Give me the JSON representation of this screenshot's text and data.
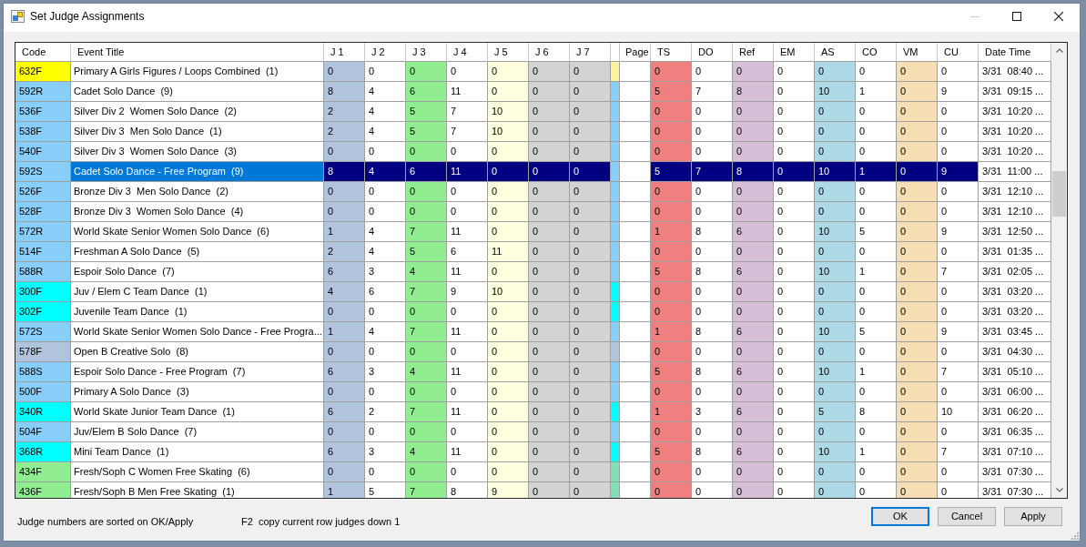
{
  "window": {
    "title": "Set Judge Assignments",
    "title_buttons": [
      {
        "kind": "minimize",
        "disabled": true
      },
      {
        "kind": "maximize",
        "disabled": false
      },
      {
        "kind": "close",
        "disabled": false
      }
    ]
  },
  "table": {
    "columns": [
      {
        "label": "Code",
        "kind": "code"
      },
      {
        "label": "Event Title",
        "kind": "title"
      },
      {
        "label": "J 1",
        "kind": "number",
        "color": "#b0c4de"
      },
      {
        "label": "J 2",
        "kind": "number"
      },
      {
        "label": "J 3",
        "kind": "number",
        "color": "#90ee90"
      },
      {
        "label": "J 4",
        "kind": "number"
      },
      {
        "label": "J 5",
        "kind": "number",
        "color": "#ffffe0"
      },
      {
        "label": "J 6",
        "kind": "number",
        "color": "#d3d3d3"
      },
      {
        "label": "J 7",
        "kind": "number",
        "color": "#d3d3d3"
      },
      {
        "kind": "marker"
      },
      {
        "label": "Page",
        "kind": "page"
      },
      {
        "label": "TS",
        "kind": "number",
        "color": "#f08080"
      },
      {
        "label": "DO",
        "kind": "number"
      },
      {
        "label": "Ref",
        "kind": "number",
        "color": "#d8bfd8"
      },
      {
        "label": "EM",
        "kind": "number"
      },
      {
        "label": "AS",
        "kind": "number",
        "color": "#add8e6"
      },
      {
        "label": "CO",
        "kind": "number"
      },
      {
        "label": "VM",
        "kind": "number",
        "color": "#f5deb3"
      },
      {
        "label": "CU",
        "kind": "number"
      },
      {
        "label": "Date Time",
        "kind": "date"
      }
    ],
    "rows": [
      {
        "code": "632F",
        "color": "#ffff00",
        "marker": {
          "color": "#fff3a0"
        },
        "title": "Primary A Girls Figures / Loops Combined  (1)",
        "values": [
          "0",
          "0",
          "0",
          "0",
          "0",
          "0",
          "0",
          "0",
          "0",
          "0",
          "0",
          "0",
          "0",
          "0",
          "0"
        ],
        "date_time": "3/31  08:40 ...",
        "selected": false
      },
      {
        "code": "592R",
        "color": "#87cefa",
        "marker": {
          "color": "#87cefa"
        },
        "title": "Cadet Solo Dance  (9)",
        "values": [
          "8",
          "4",
          "6",
          "11",
          "0",
          "0",
          "0",
          "5",
          "7",
          "8",
          "0",
          "10",
          "1",
          "0",
          "9"
        ],
        "date_time": "3/31  09:15 ...",
        "selected": false
      },
      {
        "code": "536F",
        "color": "#87cefa",
        "marker": {
          "color": "#87cefa"
        },
        "title": "Silver Div 2  Women Solo Dance  (2)",
        "values": [
          "2",
          "4",
          "5",
          "7",
          "10",
          "0",
          "0",
          "0",
          "0",
          "0",
          "0",
          "0",
          "0",
          "0",
          "0"
        ],
        "date_time": "3/31  10:20 ...",
        "selected": false
      },
      {
        "code": "538F",
        "color": "#87cefa",
        "marker": {
          "color": "#87cefa"
        },
        "title": "Silver Div 3  Men Solo Dance  (1)",
        "values": [
          "2",
          "4",
          "5",
          "7",
          "10",
          "0",
          "0",
          "0",
          "0",
          "0",
          "0",
          "0",
          "0",
          "0",
          "0"
        ],
        "date_time": "3/31  10:20 ...",
        "selected": false
      },
      {
        "code": "540F",
        "color": "#87cefa",
        "marker": {
          "color": "#87cefa"
        },
        "title": "Silver Div 3  Women Solo Dance  (3)",
        "values": [
          "0",
          "0",
          "0",
          "0",
          "0",
          "0",
          "0",
          "0",
          "0",
          "0",
          "0",
          "0",
          "0",
          "0",
          "0"
        ],
        "date_time": "3/31  10:20 ...",
        "selected": false
      },
      {
        "code": "592S",
        "color": "#87cefa",
        "marker": {
          "color": "#87cefa"
        },
        "title": "Cadet Solo Dance - Free Program  (9)",
        "values": [
          "8",
          "4",
          "6",
          "11",
          "0",
          "0",
          "0",
          "5",
          "7",
          "8",
          "0",
          "10",
          "1",
          "0",
          "9"
        ],
        "date_time": "3/31  11:00 ...",
        "selected": true
      },
      {
        "code": "526F",
        "color": "#87cefa",
        "marker": {
          "color": "#87cefa"
        },
        "title": "Bronze Div 3  Men Solo Dance  (2)",
        "values": [
          "0",
          "0",
          "0",
          "0",
          "0",
          "0",
          "0",
          "0",
          "0",
          "0",
          "0",
          "0",
          "0",
          "0",
          "0"
        ],
        "date_time": "3/31  12:10 ...",
        "selected": false
      },
      {
        "code": "528F",
        "color": "#87cefa",
        "marker": {
          "color": "#87cefa"
        },
        "title": "Bronze Div 3  Women Solo Dance  (4)",
        "values": [
          "0",
          "0",
          "0",
          "0",
          "0",
          "0",
          "0",
          "0",
          "0",
          "0",
          "0",
          "0",
          "0",
          "0",
          "0"
        ],
        "date_time": "3/31  12:10 ...",
        "selected": false
      },
      {
        "code": "572R",
        "color": "#87cefa",
        "marker": {
          "color": "#87cefa"
        },
        "title": "World Skate Senior Women Solo Dance  (6)",
        "values": [
          "1",
          "4",
          "7",
          "11",
          "0",
          "0",
          "0",
          "1",
          "8",
          "6",
          "0",
          "10",
          "5",
          "0",
          "9"
        ],
        "date_time": "3/31  12:50 ...",
        "selected": false
      },
      {
        "code": "514F",
        "color": "#87cefa",
        "marker": {
          "color": "#87cefa"
        },
        "title": "Freshman A Solo Dance  (5)",
        "values": [
          "2",
          "4",
          "5",
          "6",
          "11",
          "0",
          "0",
          "0",
          "0",
          "0",
          "0",
          "0",
          "0",
          "0",
          "0"
        ],
        "date_time": "3/31  01:35 ...",
        "selected": false
      },
      {
        "code": "588R",
        "color": "#87cefa",
        "marker": {
          "color": "#87cefa"
        },
        "title": "Espoir Solo Dance  (7)",
        "values": [
          "6",
          "3",
          "4",
          "11",
          "0",
          "0",
          "0",
          "5",
          "8",
          "6",
          "0",
          "10",
          "1",
          "0",
          "7"
        ],
        "date_time": "3/31  02:05 ...",
        "selected": false
      },
      {
        "code": "300F",
        "color": "#00ffff",
        "marker": {
          "color": "#00ffff"
        },
        "title": "Juv / Elem C Team Dance  (1)",
        "values": [
          "4",
          "6",
          "7",
          "9",
          "10",
          "0",
          "0",
          "0",
          "0",
          "0",
          "0",
          "0",
          "0",
          "0",
          "0"
        ],
        "date_time": "3/31  03:20 ...",
        "selected": false
      },
      {
        "code": "302F",
        "color": "#00ffff",
        "marker": {
          "color": "#00ffff"
        },
        "title": "Juvenile Team Dance  (1)",
        "values": [
          "0",
          "0",
          "0",
          "0",
          "0",
          "0",
          "0",
          "0",
          "0",
          "0",
          "0",
          "0",
          "0",
          "0",
          "0"
        ],
        "date_time": "3/31  03:20 ...",
        "selected": false
      },
      {
        "code": "572S",
        "color": "#87cefa",
        "marker": {
          "color": "#87cefa"
        },
        "title": "World Skate Senior Women Solo Dance - Free Progra...",
        "values": [
          "1",
          "4",
          "7",
          "11",
          "0",
          "0",
          "0",
          "1",
          "8",
          "6",
          "0",
          "10",
          "5",
          "0",
          "9"
        ],
        "date_time": "3/31  03:45 ...",
        "selected": false
      },
      {
        "code": "578F",
        "color": "#b0c4de",
        "marker": {
          "color": "#b0c4de"
        },
        "title": "Open B Creative Solo  (8)",
        "values": [
          "0",
          "0",
          "0",
          "0",
          "0",
          "0",
          "0",
          "0",
          "0",
          "0",
          "0",
          "0",
          "0",
          "0",
          "0"
        ],
        "date_time": "3/31  04:30 ...",
        "selected": false
      },
      {
        "code": "588S",
        "color": "#87cefa",
        "marker": {
          "color": "#87cefa"
        },
        "title": "Espoir Solo Dance - Free Program  (7)",
        "values": [
          "6",
          "3",
          "4",
          "11",
          "0",
          "0",
          "0",
          "5",
          "8",
          "6",
          "0",
          "10",
          "1",
          "0",
          "7"
        ],
        "date_time": "3/31  05:10 ...",
        "selected": false
      },
      {
        "code": "500F",
        "color": "#87cefa",
        "marker": {
          "color": "#87cefa"
        },
        "title": "Primary A Solo Dance  (3)",
        "values": [
          "0",
          "0",
          "0",
          "0",
          "0",
          "0",
          "0",
          "0",
          "0",
          "0",
          "0",
          "0",
          "0",
          "0",
          "0"
        ],
        "date_time": "3/31  06:00 ...",
        "selected": false
      },
      {
        "code": "340R",
        "color": "#00ffff",
        "marker": {
          "color": "#00ffff"
        },
        "title": "World Skate Junior Team Dance  (1)",
        "values": [
          "6",
          "2",
          "7",
          "11",
          "0",
          "0",
          "0",
          "1",
          "3",
          "6",
          "0",
          "5",
          "8",
          "0",
          "10"
        ],
        "date_time": "3/31  06:20 ...",
        "selected": false
      },
      {
        "code": "504F",
        "color": "#87cefa",
        "marker": {
          "color": "#87cefa"
        },
        "title": "Juv/Elem B Solo Dance  (7)",
        "values": [
          "0",
          "0",
          "0",
          "0",
          "0",
          "0",
          "0",
          "0",
          "0",
          "0",
          "0",
          "0",
          "0",
          "0",
          "0"
        ],
        "date_time": "3/31  06:35 ...",
        "selected": false
      },
      {
        "code": "368R",
        "color": "#00ffff",
        "marker": {
          "color": "#00ffff"
        },
        "title": "Mini Team Dance  (1)",
        "values": [
          "6",
          "3",
          "4",
          "11",
          "0",
          "0",
          "0",
          "5",
          "8",
          "6",
          "0",
          "10",
          "1",
          "0",
          "7"
        ],
        "date_time": "3/31  07:10 ...",
        "selected": false
      },
      {
        "code": "434F",
        "color": "#90ee90",
        "marker": {
          "color": "#7fe0b8"
        },
        "title": "Fresh/Soph C Women Free Skating  (6)",
        "values": [
          "0",
          "0",
          "0",
          "0",
          "0",
          "0",
          "0",
          "0",
          "0",
          "0",
          "0",
          "0",
          "0",
          "0",
          "0"
        ],
        "date_time": "3/31  07:30 ...",
        "selected": false
      },
      {
        "code": "436F",
        "color": "#90ee90",
        "marker": {
          "color": "#7fe0b8"
        },
        "title": "Fresh/Soph B Men Free Skating  (1)",
        "values": [
          "1",
          "5",
          "7",
          "8",
          "9",
          "0",
          "0",
          "0",
          "0",
          "0",
          "0",
          "0",
          "0",
          "0",
          "0"
        ],
        "date_time": "3/31  07:30 ...",
        "selected": false
      }
    ]
  },
  "hints": [
    "Judge numbers are sorted on OK/Apply",
    "F2  copy current row judges down 1"
  ],
  "buttons": [
    {
      "label": "OK",
      "default": true
    },
    {
      "label": "Cancel",
      "default": false
    },
    {
      "label": "Apply",
      "default": false
    }
  ]
}
